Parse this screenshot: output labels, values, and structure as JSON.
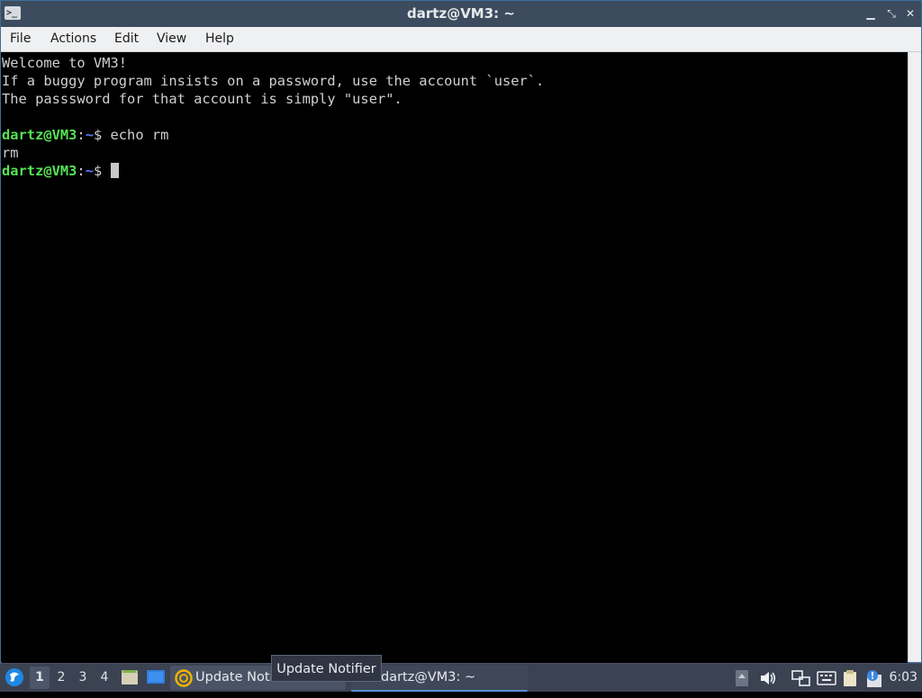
{
  "window": {
    "title": "dartz@VM3: ~",
    "icon": "terminal-icon"
  },
  "menu": {
    "items": [
      "File",
      "Actions",
      "Edit",
      "View",
      "Help"
    ]
  },
  "terminal": {
    "lines": [
      "Welcome to VM3!",
      "If a buggy program insists on a password, use the account `user`.",
      "The passsword for that account is simply \"user\"."
    ],
    "session": [
      {
        "user": "dartz@VM3",
        "sep": ":",
        "path": "~",
        "symbol": "$",
        "command": " echo rm"
      },
      {
        "output": "rm"
      },
      {
        "user": "dartz@VM3",
        "sep": ":",
        "path": "~",
        "symbol": "$",
        "command": " "
      }
    ]
  },
  "taskbar": {
    "desktops": [
      "1",
      "2",
      "3",
      "4"
    ],
    "active_desktop": "1",
    "tasks": [
      {
        "label": "Update Notifier",
        "icon": "update-notifier-icon"
      },
      {
        "label": "dartz@VM3: ~",
        "icon": "terminal-icon"
      }
    ],
    "tooltip": "Update Notifier",
    "clock": "6:03"
  },
  "colors": {
    "titlebar": "#3c4c5e",
    "prompt_user": "#55e355",
    "prompt_path": "#5c7cff",
    "taskbar": "#3b4252"
  }
}
